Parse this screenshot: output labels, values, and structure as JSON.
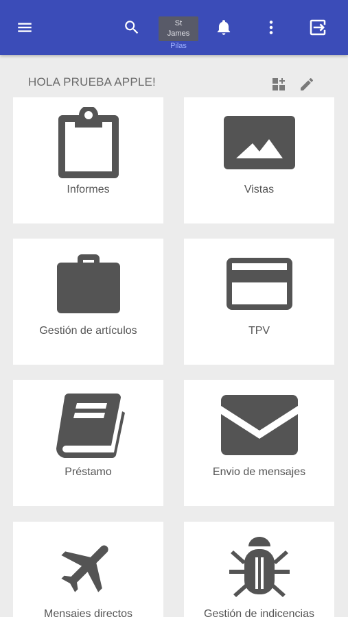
{
  "header": {
    "logo_line1": "St",
    "logo_line2": "James",
    "location": "Pilas",
    "icons": [
      "menu-icon",
      "search-icon",
      "bell-icon",
      "more-vert-icon",
      "logout-icon"
    ],
    "color": "#3b4cb8"
  },
  "greeting": "HOLA PRUEBA APPLE!",
  "greeting_icons": [
    "dashboard-customize-icon",
    "edit-pencil-icon"
  ],
  "tiles": [
    {
      "label": "Informes",
      "icon": "clipboard-icon"
    },
    {
      "label": "Vistas",
      "icon": "image-icon"
    },
    {
      "label": "Gestión de artículos",
      "icon": "briefcase-icon"
    },
    {
      "label": "TPV",
      "icon": "credit-card-icon"
    },
    {
      "label": "Préstamo",
      "icon": "book-icon"
    },
    {
      "label": "Envio de mensajes",
      "icon": "envelope-icon"
    },
    {
      "label": "Mensajes directos",
      "icon": "airplane-icon"
    },
    {
      "label": "Gestión de indicencias",
      "icon": "bug-icon"
    }
  ]
}
